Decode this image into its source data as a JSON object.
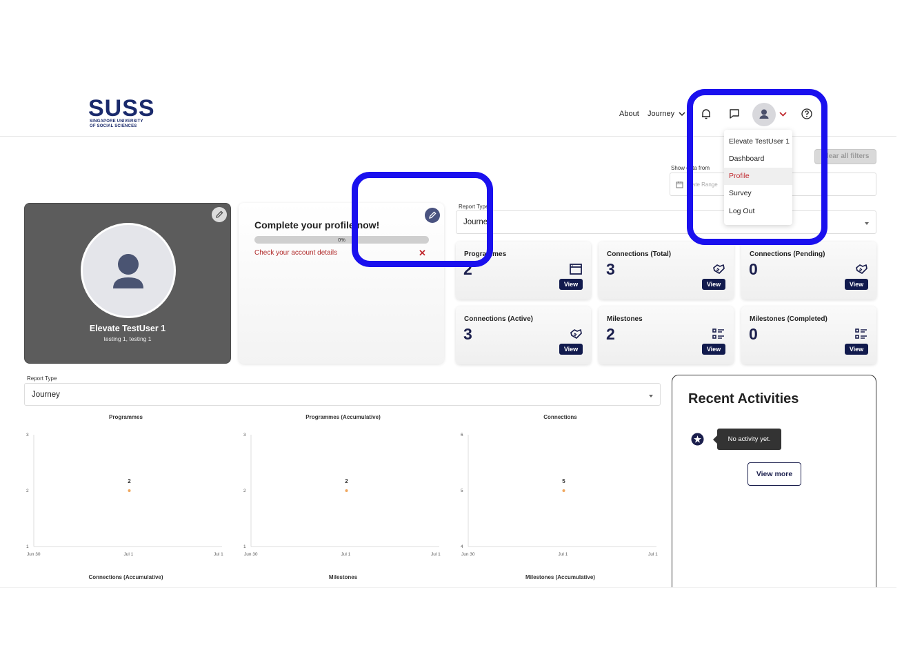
{
  "logo": {
    "word": "SUSS",
    "line1": "SINGAPORE UNIVERSITY",
    "line2": "OF SOCIAL SCIENCES"
  },
  "nav": {
    "about": "About",
    "journey": "Journey"
  },
  "user_menu": {
    "items": [
      {
        "label": "Elevate TestUser 1"
      },
      {
        "label": "Dashboard"
      },
      {
        "label": "Profile",
        "active": true
      },
      {
        "label": "Survey"
      },
      {
        "label": "Log Out"
      }
    ]
  },
  "filters": {
    "clear_label": "Clear all filters",
    "show_label": "Show data from",
    "date_placeholder": "Date Range",
    "report_type_label": "Report Type",
    "report_type_value": "Journey"
  },
  "profile": {
    "name": "Elevate TestUser 1",
    "subtitle": "testing 1, testing 1"
  },
  "complete_profile": {
    "title": "Complete your profile now!",
    "progress_text": "0%",
    "progress": 0,
    "link": "Check your account details"
  },
  "stats": [
    {
      "title": "Programmes",
      "value": "2",
      "icon": "window-icon",
      "view": "View"
    },
    {
      "title": "Connections (Total)",
      "value": "3",
      "icon": "handshake-icon",
      "view": "View"
    },
    {
      "title": "Connections (Pending)",
      "value": "0",
      "icon": "handshake-icon",
      "view": "View"
    },
    {
      "title": "Connections (Active)",
      "value": "3",
      "icon": "handshake-icon",
      "view": "View"
    },
    {
      "title": "Milestones",
      "value": "2",
      "icon": "checklist-icon",
      "view": "View"
    },
    {
      "title": "Milestones (Completed)",
      "value": "0",
      "icon": "checklist-icon",
      "view": "View"
    }
  ],
  "report": {
    "label": "Report Type",
    "value": "Journey"
  },
  "chart_data": [
    {
      "type": "scatter",
      "title": "Programmes",
      "x": [
        "Jul 1"
      ],
      "values": [
        2
      ],
      "x_ticks": [
        "Jun 30",
        "Jul 1",
        "Jul 1"
      ],
      "y_ticks": [
        "3",
        "2",
        "1"
      ],
      "ylim": [
        1,
        3
      ],
      "color": "#f0a860"
    },
    {
      "type": "scatter",
      "title": "Programmes (Accumulative)",
      "x": [
        "Jul 1"
      ],
      "values": [
        2
      ],
      "x_ticks": [
        "Jun 30",
        "Jul 1",
        "Jul 1"
      ],
      "y_ticks": [
        "3",
        "2",
        "1"
      ],
      "ylim": [
        1,
        3
      ],
      "color": "#f0a860"
    },
    {
      "type": "scatter",
      "title": "Connections",
      "x": [
        "Jul 1"
      ],
      "values": [
        5
      ],
      "x_ticks": [
        "Jun 30",
        "Jul 1",
        "Jul 1"
      ],
      "y_ticks": [
        "6",
        "5",
        "4"
      ],
      "ylim": [
        4,
        6
      ],
      "color": "#f0a860"
    },
    {
      "type": "scatter",
      "title": "Connections (Accumulative)",
      "x": [],
      "values": []
    },
    {
      "type": "scatter",
      "title": "Milestones",
      "x": [],
      "values": []
    },
    {
      "type": "scatter",
      "title": "Milestones (Accumulative)",
      "x": [],
      "values": []
    }
  ],
  "recent": {
    "title": "Recent Activities",
    "empty": "No activity yet.",
    "view_more": "View more"
  },
  "colors": {
    "brand_navy": "#1b1f4d",
    "accent_red": "#c0282e",
    "highlight": "#1a10ee"
  }
}
